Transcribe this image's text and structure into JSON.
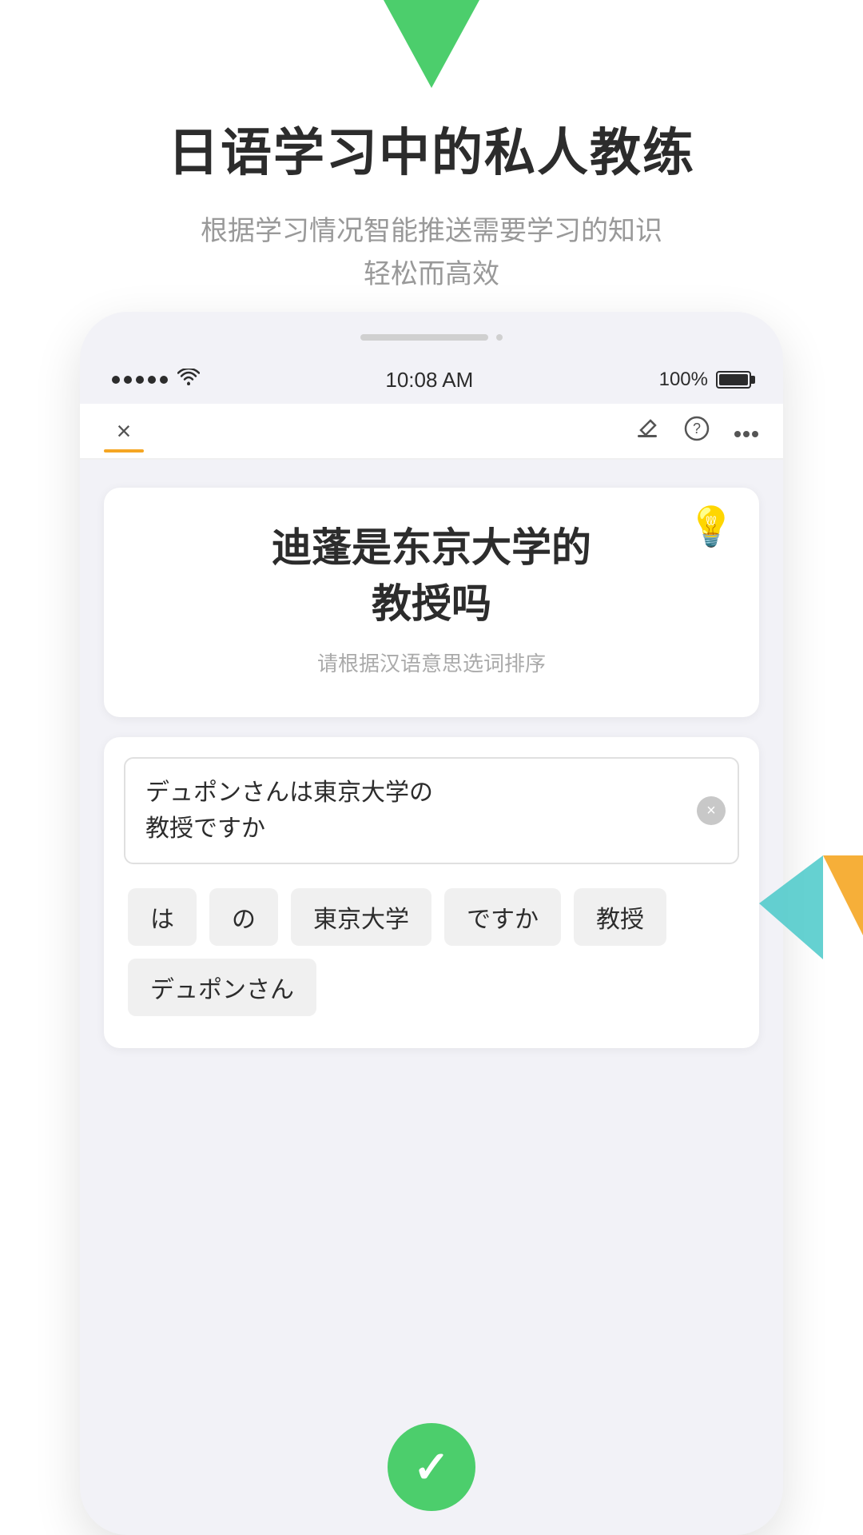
{
  "logo": {
    "alt": "app-logo-triangle"
  },
  "header": {
    "main_title": "日语学习中的私人教练",
    "sub_title_line1": "根据学习情况智能推送需要学习的知识",
    "sub_title_line2": "轻松而高效"
  },
  "status_bar": {
    "time": "10:08 AM",
    "battery_percent": "100%"
  },
  "nav": {
    "close_label": "×",
    "icons": [
      "edit-icon",
      "help-icon",
      "more-icon"
    ]
  },
  "question_card": {
    "question_text_line1": "迪蓬是东京大学的",
    "question_text_line2": "教授吗",
    "hint_text": "请根据汉语意思选词排序",
    "lightbulb": "💡"
  },
  "answer_card": {
    "answer_text_line1": "デュポンさんは東京大学の",
    "answer_text_line2": "教授ですか",
    "word_chips": [
      "は",
      "の",
      "東京大学",
      "ですか",
      "教授",
      "デュポンさん"
    ]
  },
  "bottom_button": {
    "check_mark": "✓"
  }
}
